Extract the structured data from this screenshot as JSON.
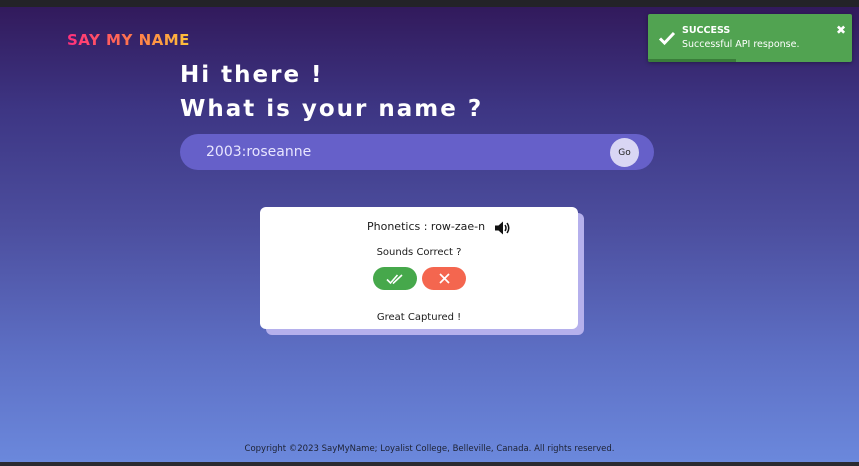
{
  "brand": {
    "title": "SAY MY NAME"
  },
  "hero": {
    "line1": "Hi there !",
    "line2": "What is your name ?"
  },
  "search": {
    "value": "2003:roseanne",
    "go_label": "Go"
  },
  "result": {
    "phonetics": "Phonetics : row-zae-n",
    "sounds_correct": "Sounds Correct ?",
    "captured_message": "Great Captured !"
  },
  "footer": {
    "copyright": "Copyright ©2023 SayMyName; Loyalist College, Belleville, Canada. All rights reserved."
  },
  "toast": {
    "title": "SUCCESS",
    "message": "Successful API response.",
    "close_symbol": "✖",
    "progress": 0.43,
    "color": "#51a351"
  },
  "colors": {
    "brand_gradient": [
      "#ff2f7d",
      "#ffc33a"
    ],
    "search_bar": "#6660c9",
    "correct_button": "#46a84b",
    "incorrect_button": "#f4664f"
  },
  "icons": {
    "speaker": "speaker-icon",
    "correct": "double-check-icon",
    "incorrect": "close-icon",
    "toast": "check-icon"
  }
}
